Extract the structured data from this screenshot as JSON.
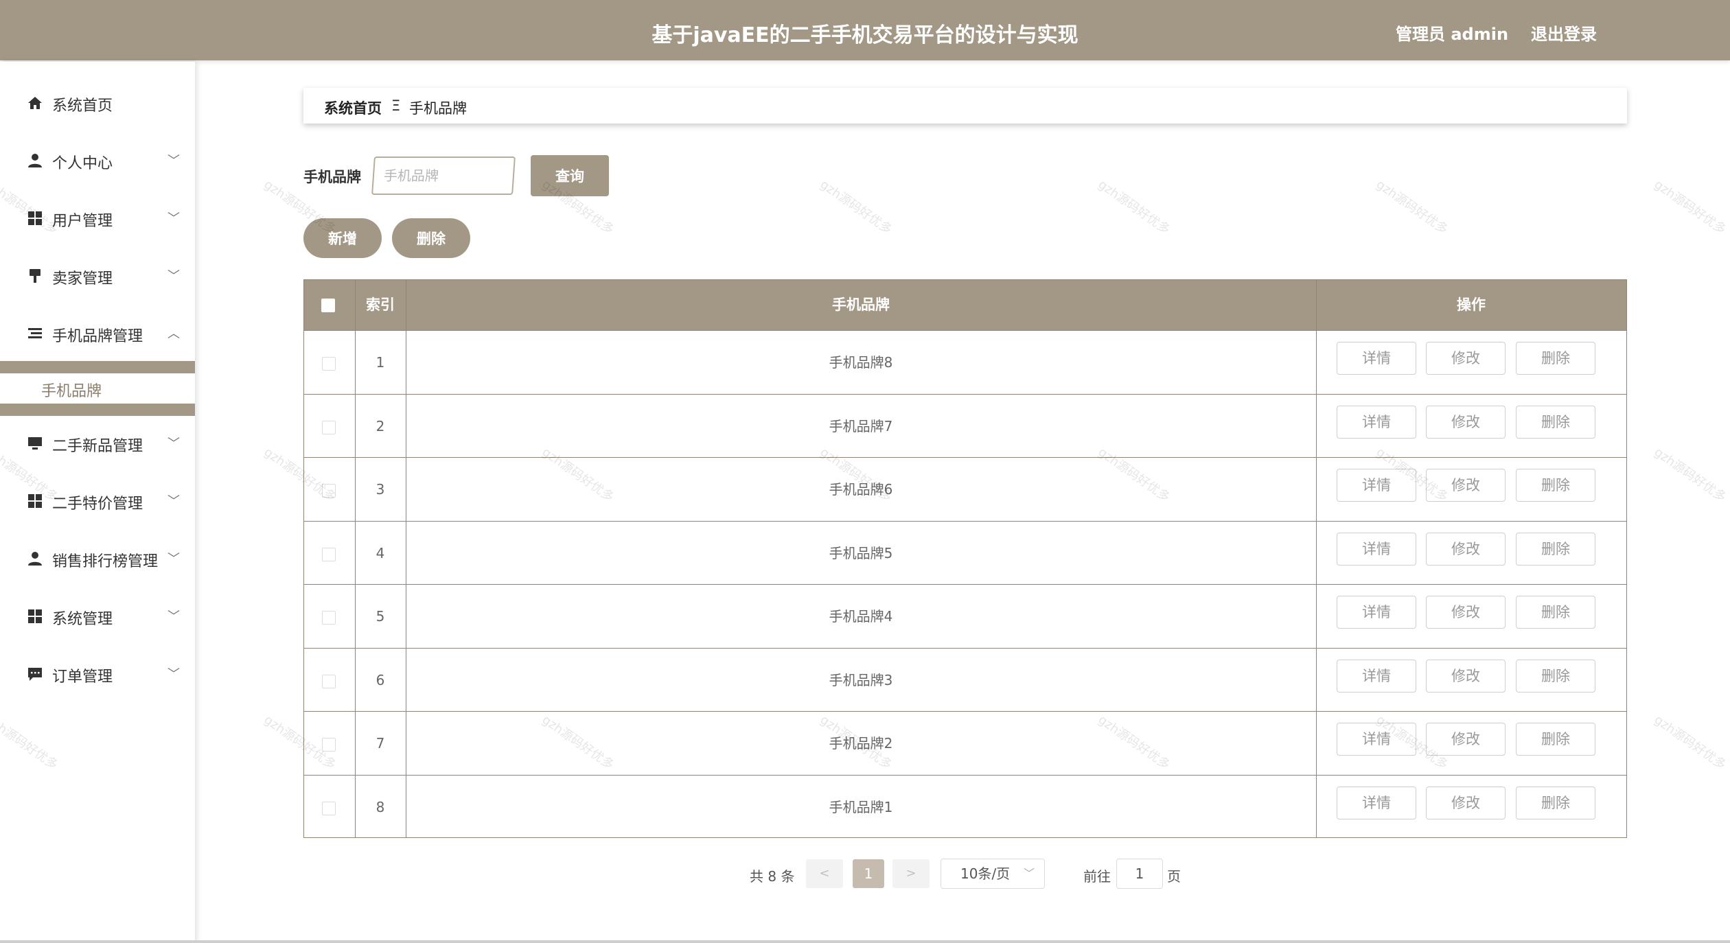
{
  "header": {
    "title": "基于javaEE的二手手机交易平台的设计与实现",
    "user": "管理员 admin",
    "logout": "退出登录"
  },
  "sidebar": {
    "items": [
      {
        "label": "系统首页",
        "icon": "home-icon",
        "glyph": "⌂"
      },
      {
        "label": "个人中心",
        "icon": "user-icon",
        "glyph": "👤"
      },
      {
        "label": "用户管理",
        "icon": "grid-icon",
        "glyph": "▦"
      },
      {
        "label": "卖家管理",
        "icon": "stamp-icon",
        "glyph": "▾"
      },
      {
        "label": "手机品牌管理",
        "icon": "list-icon",
        "glyph": "☰"
      },
      {
        "label": "二手新品管理",
        "icon": "monitor-icon",
        "glyph": "▭"
      },
      {
        "label": "二手特价管理",
        "icon": "grid-icon",
        "glyph": "▦"
      },
      {
        "label": "销售排行榜管理",
        "icon": "user-icon",
        "glyph": "👤"
      },
      {
        "label": "系统管理",
        "icon": "grid-icon",
        "glyph": "▦"
      },
      {
        "label": "订单管理",
        "icon": "chat-icon",
        "glyph": "▤"
      }
    ],
    "submenu_label": "手机品牌"
  },
  "breadcrumb": {
    "home": "系统首页",
    "separator": "Ξ",
    "current": "手机品牌"
  },
  "search": {
    "label": "手机品牌",
    "placeholder": "手机品牌",
    "value": "",
    "button": "查询"
  },
  "actions": {
    "add": "新增",
    "delete": "删除"
  },
  "table": {
    "columns": [
      "索引",
      "手机品牌",
      "操作"
    ],
    "row_actions": [
      "详情",
      "修改",
      "删除"
    ],
    "rows": [
      {
        "index": "1",
        "brand": "手机品牌8"
      },
      {
        "index": "2",
        "brand": "手机品牌7"
      },
      {
        "index": "3",
        "brand": "手机品牌6"
      },
      {
        "index": "4",
        "brand": "手机品牌5"
      },
      {
        "index": "5",
        "brand": "手机品牌4"
      },
      {
        "index": "6",
        "brand": "手机品牌3"
      },
      {
        "index": "7",
        "brand": "手机品牌2"
      },
      {
        "index": "8",
        "brand": "手机品牌1"
      }
    ]
  },
  "pagination": {
    "total": "共 8 条",
    "prev": "<",
    "current": "1",
    "next": ">",
    "page_size": "10条/页",
    "goto": "前往",
    "goto_value": "1",
    "page_suffix": "页"
  },
  "watermark": "gzh源码好优多",
  "colors": {
    "accent": "#a39886",
    "border": "#8f8576",
    "submenu_text": "#8a7e6c"
  }
}
